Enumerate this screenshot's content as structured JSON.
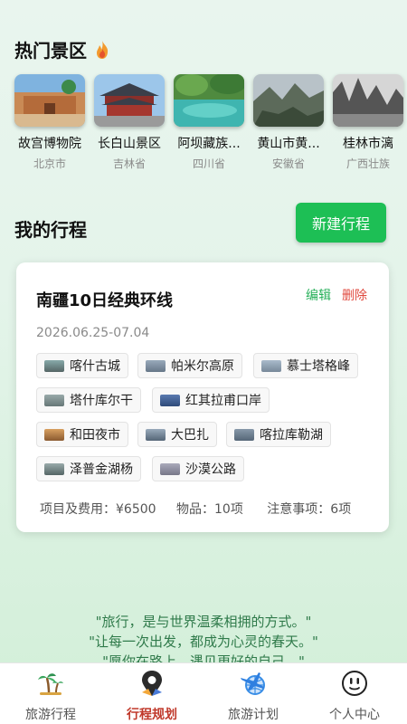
{
  "hot_spots": {
    "title": "热门景区",
    "title_icon": "fire-icon",
    "items": [
      {
        "name": "故宫博物院",
        "province": "北京市"
      },
      {
        "name": "长白山景区",
        "province": "吉林省"
      },
      {
        "name": "阿坝藏族...",
        "province": "四川省"
      },
      {
        "name": "黄山市黄...",
        "province": "安徽省"
      },
      {
        "name": "桂林市漓",
        "province": "广西壮族"
      }
    ]
  },
  "my_trips": {
    "title": "我的行程",
    "new_button": "新建行程"
  },
  "trip_card": {
    "title": "南疆10日经典环线",
    "edit": "编辑",
    "delete": "删除",
    "dates": "2026.06.25-07.04",
    "places": [
      "喀什古城",
      "帕米尔高原",
      "慕士塔格峰",
      "塔什库尔干",
      "红其拉甫口岸",
      "和田夜市",
      "大巴扎",
      "喀拉库勒湖",
      "泽普金湖杨",
      "沙漠公路"
    ],
    "stats": {
      "cost": "项目及费用：¥6500",
      "items": "物品：10项",
      "notes": "注意事项：6项"
    }
  },
  "quotes": [
    "\"旅行，是与世界温柔相拥的方式。\"",
    "\"让每一次出发，都成为心灵的春天。\"",
    "\"愿你在路上，遇见更好的自己。\""
  ],
  "tabs": [
    {
      "label": "旅游行程",
      "icon": "palm-tree-icon"
    },
    {
      "label": "行程规划",
      "icon": "map-pin-icon",
      "active": true
    },
    {
      "label": "旅游计划",
      "icon": "airplane-globe-icon"
    },
    {
      "label": "个人中心",
      "icon": "smiley-face-icon"
    }
  ],
  "colors": {
    "accent_green": "#1dbf55",
    "delete_red": "#e04a3f",
    "active_tab": "#c0392b",
    "quote_green": "#2f7a4a"
  }
}
